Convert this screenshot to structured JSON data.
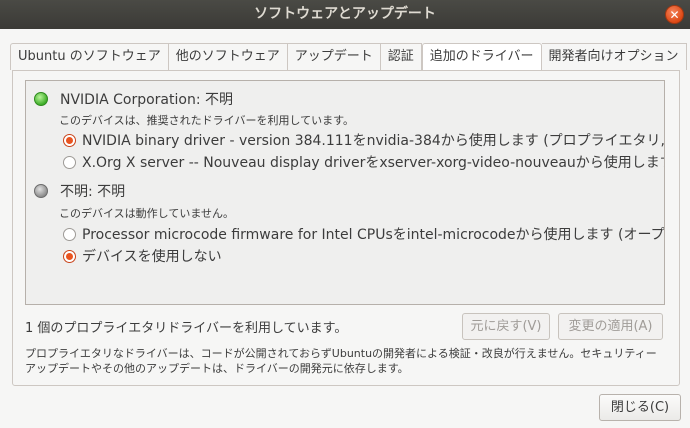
{
  "window": {
    "title": "ソフトウェアとアップデート",
    "close_glyph": "✕"
  },
  "tabs": [
    {
      "label": "Ubuntu のソフトウェア"
    },
    {
      "label": "他のソフトウェア"
    },
    {
      "label": "アップデート"
    },
    {
      "label": "認証"
    },
    {
      "label": "追加のドライバー",
      "active": true
    },
    {
      "label": "開発者向けオプション"
    }
  ],
  "devices": [
    {
      "led": "green",
      "title": "NVIDIA Corporation: 不明",
      "note": "このデバイスは、推奨されたドライバーを利用しています。",
      "options": [
        {
          "label": "NVIDIA binary driver - version 384.111をnvidia-384から使用します (プロプライエタリ, 検証済",
          "selected": true
        },
        {
          "label": "X.Org X server -- Nouveau display driverをxserver-xorg-video-nouveauから使用します (オー",
          "selected": false
        }
      ]
    },
    {
      "led": "gray",
      "title": "不明: 不明",
      "note": "このデバイスは動作していません。",
      "options": [
        {
          "label": "Processor microcode firmware for Intel CPUsをintel-microcodeから使用します (オープンソ",
          "selected": false
        },
        {
          "label": "デバイスを使用しない",
          "selected": true
        }
      ]
    }
  ],
  "status": "1 個のプロプライエタリドライバーを利用しています。",
  "buttons": {
    "revert": "元に戻す(V)",
    "apply": "変更の適用(A)",
    "close": "閉じる(C)"
  },
  "footnote": "プロプライエタリなドライバーは、コードが公開されておらずUbuntuの開発者による検証・改良が行えません。セキュリティーアップデートやその他のアップデートは、ドライバーの開発元に依存します。",
  "colors": {
    "accent": "#e95420",
    "title_bar": "#3b3a36"
  }
}
